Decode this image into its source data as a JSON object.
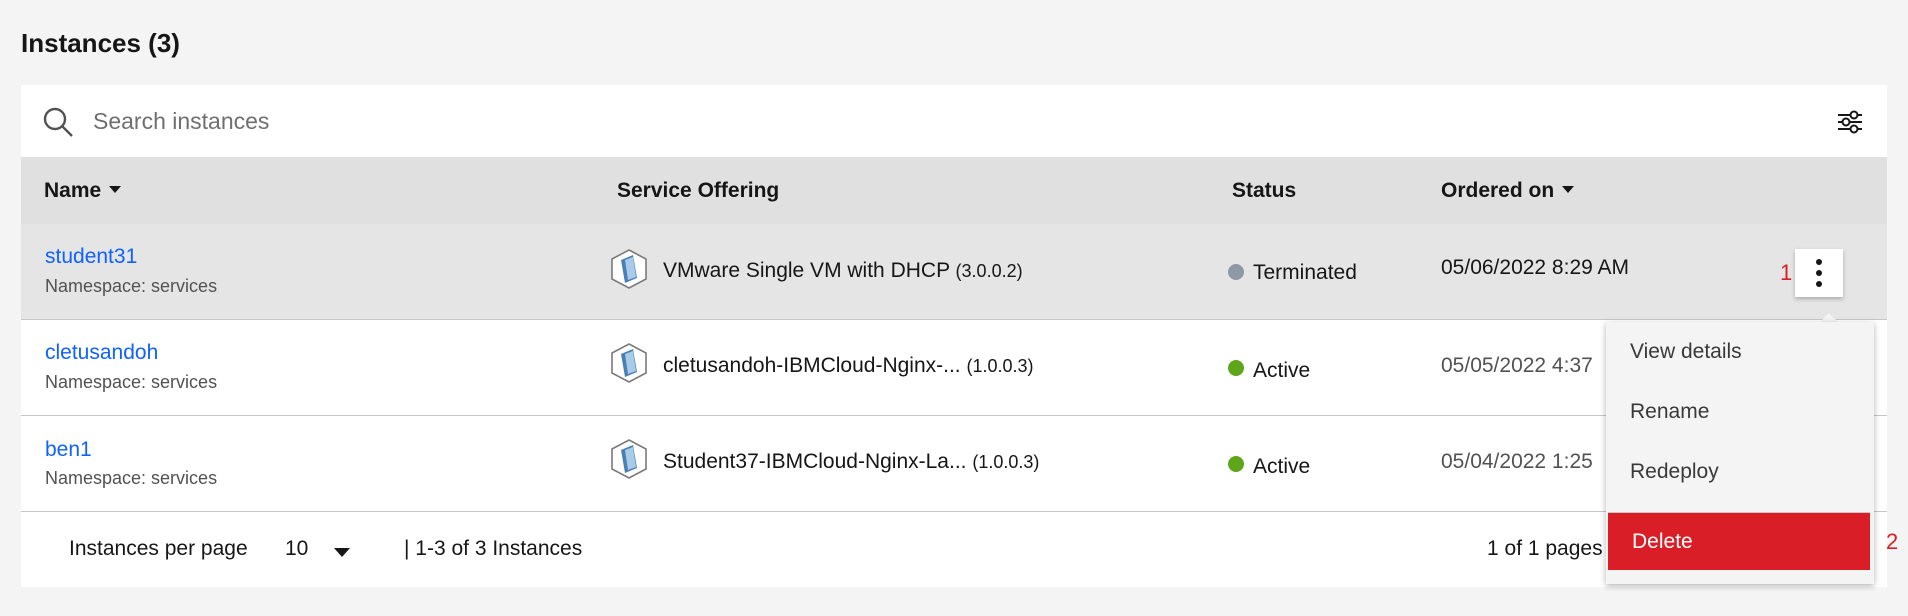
{
  "page": {
    "title": "Instances (3)"
  },
  "search": {
    "placeholder": "Search instances"
  },
  "table": {
    "headers": {
      "name": "Name",
      "service_offering": "Service Offering",
      "status": "Status",
      "ordered_on": "Ordered on"
    },
    "rows": [
      {
        "name": "student31",
        "namespace": "Namespace: services",
        "offering": "VMware Single VM with DHCP",
        "version": "(3.0.0.2)",
        "status": "Terminated",
        "status_color": "#8d9aa5",
        "ordered_on": "05/06/2022 8:29 AM"
      },
      {
        "name": "cletusandoh",
        "namespace": "Namespace: services",
        "offering": "cletusandoh-IBMCloud-Nginx-...",
        "version": "(1.0.0.3)",
        "status": "Active",
        "status_color": "#5fa51c",
        "ordered_on": "05/05/2022 4:37"
      },
      {
        "name": "ben1",
        "namespace": "Namespace: services",
        "offering": "Student37-IBMCloud-Nginx-La...",
        "version": "(1.0.0.3)",
        "status": "Active",
        "status_color": "#5fa51c",
        "ordered_on": "05/04/2022 1:25"
      }
    ]
  },
  "overflow_menu": {
    "items": [
      "View details",
      "Rename",
      "Redeploy",
      "Delete"
    ]
  },
  "annotations": {
    "first": "1",
    "second": "2"
  },
  "pagination": {
    "per_page_label": "Instances per page",
    "per_page_value": "10",
    "range": "|  1-3 of 3 Instances",
    "pages": "1 of 1 pages"
  },
  "colors": {
    "link": "#0f62fe",
    "danger": "#da1e28",
    "header_bg": "#e0e0e0"
  }
}
